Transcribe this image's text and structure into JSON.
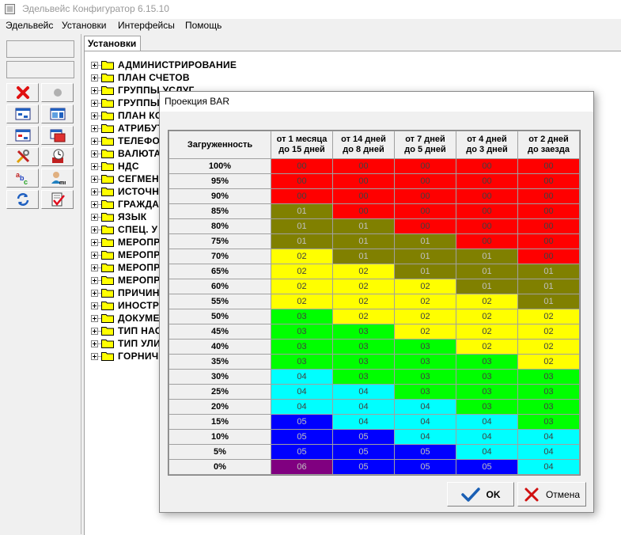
{
  "window": {
    "title": "Эдельвейс Конфигуратор 6.15.10"
  },
  "menu": [
    {
      "label": "Эдельвейс"
    },
    {
      "label": "Установки"
    },
    {
      "label": "Интерфейсы"
    },
    {
      "label": "Помощь"
    }
  ],
  "toolbar": {
    "icons": [
      "delete-x-icon",
      "record-icon",
      "grid-view-icon",
      "grid-layout-icon",
      "grid-edit-icon",
      "grid-copy-icon",
      "tools-icon",
      "clock-icon",
      "spelling-icon",
      "user-icon",
      "refresh-icon",
      "checklist-icon"
    ]
  },
  "tab": {
    "label": "Установки"
  },
  "tree": [
    {
      "label": "АДМИНИСТРИРОВАНИЕ"
    },
    {
      "label": "ПЛАН СЧЕТОВ"
    },
    {
      "label": "ГРУППЫ УСЛУГ"
    },
    {
      "label": "ГРУППЫ"
    },
    {
      "label": "ПЛАН КО"
    },
    {
      "label": "АТРИБУТ"
    },
    {
      "label": "ТЕЛЕФО"
    },
    {
      "label": "ВАЛЮТА"
    },
    {
      "label": "НДС"
    },
    {
      "label": "СЕГМЕНТ"
    },
    {
      "label": "ИСТОЧН"
    },
    {
      "label": "ГРАЖДА"
    },
    {
      "label": "ЯЗЫК"
    },
    {
      "label": "СПЕЦ. У"
    },
    {
      "label": "МЕРОПР"
    },
    {
      "label": "МЕРОПР"
    },
    {
      "label": "МЕРОПР"
    },
    {
      "label": "МЕРОПР"
    },
    {
      "label": "ПРИЧИН"
    },
    {
      "label": "ИНОСТР"
    },
    {
      "label": "ДОКУМЕ"
    },
    {
      "label": "ТИП НАС"
    },
    {
      "label": "ТИП УЛИ"
    },
    {
      "label": "ГОРНИЧ"
    }
  ],
  "dialog": {
    "title": "Проекция BAR",
    "header_corner": "Загруженность",
    "columns": [
      {
        "line1": "от 1 месяца",
        "line2": "до 15 дней"
      },
      {
        "line1": "от 14 дней",
        "line2": "до 8 дней"
      },
      {
        "line1": "от 7 дней",
        "line2": "до 5 дней"
      },
      {
        "line1": "от 4 дней",
        "line2": "до 3 дней"
      },
      {
        "line1": "от 2 дней",
        "line2": "до заезда"
      }
    ],
    "colors": {
      "00": "#ff0000",
      "01": "#808000",
      "02": "#ffff00",
      "03": "#00ff00",
      "04": "#00ffff",
      "05": "#0000ff",
      "06": "#800080"
    },
    "rows": [
      {
        "label": "100%",
        "cells": [
          "00",
          "00",
          "00",
          "00",
          "00"
        ]
      },
      {
        "label": "95%",
        "cells": [
          "00",
          "00",
          "00",
          "00",
          "00"
        ]
      },
      {
        "label": "90%",
        "cells": [
          "00",
          "00",
          "00",
          "00",
          "00"
        ]
      },
      {
        "label": "85%",
        "cells": [
          "01",
          "00",
          "00",
          "00",
          "00"
        ]
      },
      {
        "label": "80%",
        "cells": [
          "01",
          "01",
          "00",
          "00",
          "00"
        ]
      },
      {
        "label": "75%",
        "cells": [
          "01",
          "01",
          "01",
          "00",
          "00"
        ]
      },
      {
        "label": "70%",
        "cells": [
          "02",
          "01",
          "01",
          "01",
          "00"
        ]
      },
      {
        "label": "65%",
        "cells": [
          "02",
          "02",
          "01",
          "01",
          "01"
        ]
      },
      {
        "label": "60%",
        "cells": [
          "02",
          "02",
          "02",
          "01",
          "01"
        ]
      },
      {
        "label": "55%",
        "cells": [
          "02",
          "02",
          "02",
          "02",
          "01"
        ]
      },
      {
        "label": "50%",
        "cells": [
          "03",
          "02",
          "02",
          "02",
          "02"
        ]
      },
      {
        "label": "45%",
        "cells": [
          "03",
          "03",
          "02",
          "02",
          "02"
        ]
      },
      {
        "label": "40%",
        "cells": [
          "03",
          "03",
          "03",
          "02",
          "02"
        ]
      },
      {
        "label": "35%",
        "cells": [
          "03",
          "03",
          "03",
          "03",
          "02"
        ]
      },
      {
        "label": "30%",
        "cells": [
          "04",
          "03",
          "03",
          "03",
          "03"
        ]
      },
      {
        "label": "25%",
        "cells": [
          "04",
          "04",
          "03",
          "03",
          "03"
        ]
      },
      {
        "label": "20%",
        "cells": [
          "04",
          "04",
          "04",
          "03",
          "03"
        ]
      },
      {
        "label": "15%",
        "cells": [
          "05",
          "04",
          "04",
          "04",
          "03"
        ]
      },
      {
        "label": "10%",
        "cells": [
          "05",
          "05",
          "04",
          "04",
          "04"
        ]
      },
      {
        "label": "5%",
        "cells": [
          "05",
          "05",
          "05",
          "04",
          "04"
        ]
      },
      {
        "label": "0%",
        "cells": [
          "06",
          "05",
          "05",
          "05",
          "04"
        ]
      }
    ],
    "ok_label": "OK",
    "cancel_label": "Отмена"
  }
}
